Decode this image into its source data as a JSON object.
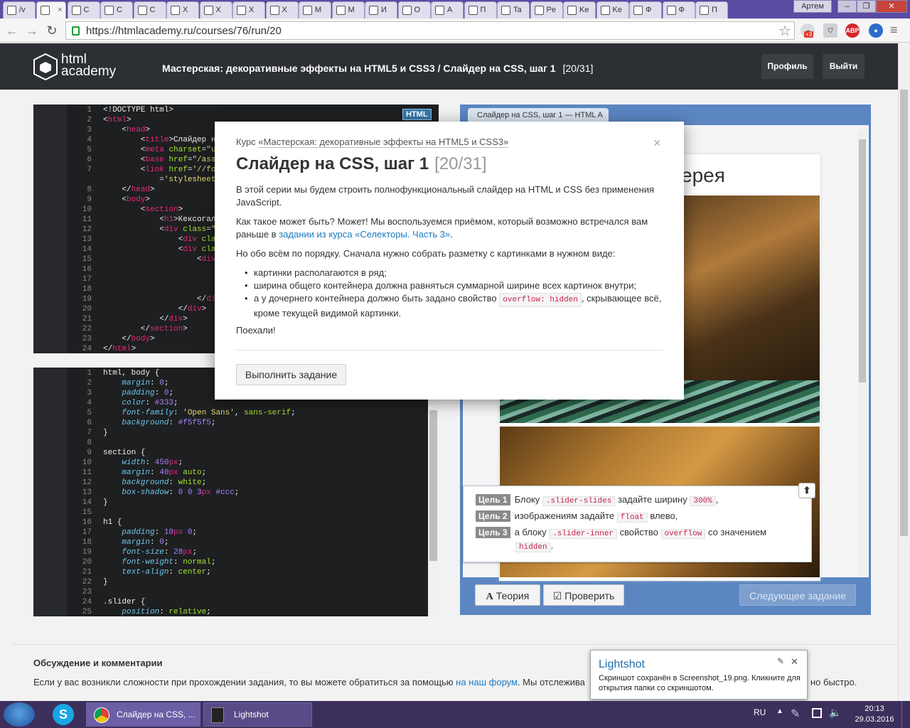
{
  "browser": {
    "tabs": [
      {
        "label": "/v"
      },
      {
        "label": ""
      },
      {
        "label": "C"
      },
      {
        "label": "C"
      },
      {
        "label": "C"
      },
      {
        "label": "X"
      },
      {
        "label": "X"
      },
      {
        "label": "X"
      },
      {
        "label": "X"
      },
      {
        "label": "M"
      },
      {
        "label": "M"
      },
      {
        "label": "И"
      },
      {
        "label": "O"
      },
      {
        "label": "A"
      },
      {
        "label": "П"
      },
      {
        "label": "Ta"
      },
      {
        "label": "Pe"
      },
      {
        "label": "Ke"
      },
      {
        "label": "Ke"
      },
      {
        "label": "Ф"
      },
      {
        "label": "Ф"
      },
      {
        "label": "П"
      }
    ],
    "user": "Артем",
    "url": "https://htmlacademy.ru/courses/76/run/20",
    "ext_badge": "+3",
    "abp": "ABP"
  },
  "site": {
    "logo_line1": "html",
    "logo_line2": "academy",
    "breadcrumb": "Мастерская: декоративные эффекты на HTML5 и CSS3 / Слайдер на CSS, шаг 1",
    "counter": "[20/31]",
    "profile_btn": "Профиль",
    "logout_btn": "Выйти"
  },
  "html_editor": {
    "badge": "HTML",
    "lines": [
      "1",
      "2",
      "3",
      "4",
      "5",
      "6",
      "7",
      "",
      "8",
      "9",
      "10",
      "11",
      "12",
      "13",
      "14",
      "15",
      "16",
      "17",
      "18",
      "19",
      "20",
      "21",
      "22",
      "23",
      "24"
    ]
  },
  "css_editor": {
    "lines": [
      "1",
      "2",
      "3",
      "4",
      "5",
      "6",
      "7",
      "8",
      "9",
      "10",
      "11",
      "12",
      "13",
      "14",
      "15",
      "16",
      "17",
      "18",
      "19",
      "20",
      "21",
      "22",
      "23",
      "24",
      "25"
    ]
  },
  "preview": {
    "tab": "Слайдер на CSS, шаг 1 — HTML A",
    "title_fragment": "ерея",
    "goals": {
      "g1_tag": "Цель 1",
      "g1_a": "Блоку",
      "g1_code": ".slider-slides",
      "g1_b": "задайте ширину",
      "g1_val": "300%",
      "g1_end": ",",
      "g2_tag": "Цель 2",
      "g2_a": "изображениям задайте",
      "g2_code": "float",
      "g2_b": "влево,",
      "g3_tag": "Цель 3",
      "g3_a": "а блоку",
      "g3_code": ".slider-inner",
      "g3_b": "свойство",
      "g3_prop": "overflow",
      "g3_c": "со значением",
      "g3_val": "hidden",
      "g3_end": "."
    },
    "theory_btn": "Теория",
    "check_btn": "Проверить",
    "next_btn": "Следующее задание"
  },
  "modal": {
    "course_prefix": "Курс",
    "course_link": "«Мастерская: декоративные эффекты на HTML5 и CSS3»",
    "title": "Слайдер на CSS, шаг 1",
    "counter": "[20/31]",
    "p1": "В этой серии мы будем строить полнофункциональный слайдер на HTML и CSS без применения JavaScript.",
    "p2_a": "Как такое может быть? Может! Мы воспользуемся приёмом, который возможно встречался вам раньше в",
    "p2_link": "задании из курса «Селекторы. Часть 3»",
    "p2_end": ".",
    "p3": "Но обо всём по порядку. Сначала нужно собрать разметку с картинками в нужном виде:",
    "li1": "картинки располагаются в ряд;",
    "li2": "ширина общего контейнера должна равняться суммарной ширине всех картинок внутри;",
    "li3_a": "а у дочернего контейнера должно быть задано свойство",
    "li3_code": "overflow: hidden",
    "li3_b": ", скрывающее всё, кроме текущей видимой картинки.",
    "p4": "Поехали!",
    "button": "Выполнить задание",
    "close": "×"
  },
  "discussion": {
    "title": "Обсуждение и комментарии",
    "text_a": "Если у вас возникли сложности при прохождении задания, то вы можете обратиться за помощью",
    "link": "на наш форум",
    "text_b": ". Мы отслежива",
    "text_end": "но быстро."
  },
  "lightshot": {
    "title": "Lightshot",
    "text": "Скриншот сохранён в Screenshot_19.png. Кликните для открытия папки со скриншотом."
  },
  "taskbar": {
    "chrome_item": "Слайдер на CSS, ...",
    "lightshot_item": "Lightshot",
    "lang": "RU",
    "time": "20:13",
    "date": "29.03.2016"
  }
}
